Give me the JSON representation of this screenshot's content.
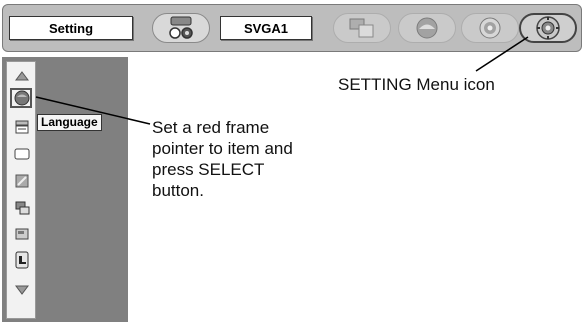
{
  "toolbar": {
    "setting_label": "Setting",
    "source_label": "SVGA1",
    "icons": [
      "input-source-icon",
      "screen-icon",
      "color-icon",
      "sound-icon",
      "setting-menu-icon"
    ]
  },
  "sidebar": {
    "items": [
      "scroll-up-icon",
      "language-icon",
      "keystone-icon",
      "blue-back-icon",
      "display-icon",
      "logo-icon",
      "ceiling-icon",
      "rear-icon",
      "scroll-down-icon"
    ],
    "highlighted_label": "Language"
  },
  "annotations": {
    "setting_icon_note": "SETTING Menu icon",
    "instruction_lines": [
      "Set a red frame",
      "pointer to item and",
      "press SELECT",
      "button."
    ]
  }
}
